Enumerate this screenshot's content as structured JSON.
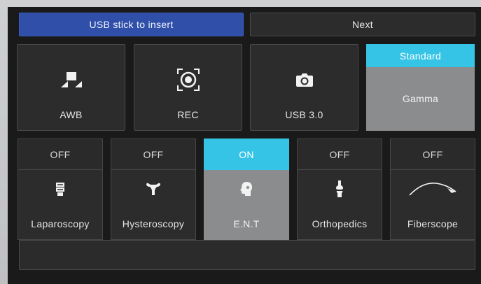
{
  "topbar": {
    "usb_label": "USB stick to insert",
    "next_label": "Next"
  },
  "tiles": {
    "awb": {
      "label": "AWB",
      "icon": "white-balance-icon"
    },
    "rec": {
      "label": "REC",
      "icon": "record-icon"
    },
    "usb3": {
      "label": "USB 3.0",
      "icon": "camera-icon"
    },
    "gamma": {
      "label": "Gamma",
      "mode": "Standard"
    }
  },
  "modes": [
    {
      "state": "OFF",
      "label": "Laparoscopy",
      "icon": "intestine-icon",
      "active": false
    },
    {
      "state": "OFF",
      "label": "Hysteroscopy",
      "icon": "uterus-icon",
      "active": false
    },
    {
      "state": "ON",
      "label": "E.N.T",
      "icon": "head-profile-icon",
      "active": true
    },
    {
      "state": "OFF",
      "label": "Orthopedics",
      "icon": "knee-joint-icon",
      "active": false
    },
    {
      "state": "OFF",
      "label": "Fiberscope",
      "icon": "fiberscope-icon",
      "active": false
    }
  ],
  "status": {
    "text": ""
  },
  "colors": {
    "usb_button": "#2f4fa8",
    "on_state": "#36c4e6",
    "active_tile": "#8b8c8e",
    "background": "#1a1a1a"
  }
}
